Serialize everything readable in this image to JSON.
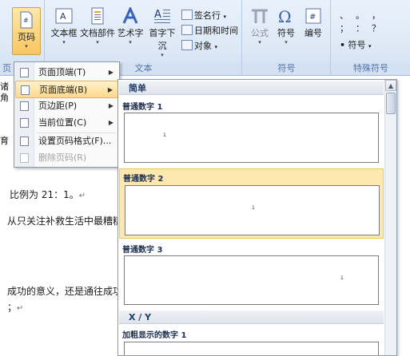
{
  "ribbon": {
    "page_number_btn": "页码",
    "insert_text_group": {
      "textbox": "文本框",
      "quickparts": "文档部件",
      "wordart": "艺术字",
      "dropcap": "首字下沉",
      "signature_line": "签名行",
      "datetime": "日期和时间",
      "object": "对象",
      "label": "文本"
    },
    "symbols_group": {
      "equation": "公式",
      "symbol": "符号",
      "numbering": "编号",
      "label": "符号"
    },
    "special_group": {
      "symbol_btn": "符号",
      "label": "特殊符号",
      "glyphs": [
        "、",
        "。",
        "，",
        "；",
        "：",
        "？"
      ]
    },
    "hdr_label_fragment": "页",
    "dd_arrow": "▾"
  },
  "document": {
    "lines": [
      {
        "text": "比例为 21：1。",
        "mark": "↵"
      },
      {
        "text": "从只关注补救生活中最糟糕"
      },
      {
        "text": "成功的意义，还是通往成功"
      },
      {
        "text": "；",
        "mark": "↵"
      }
    ],
    "edge_fragments": [
      "诸",
      "角",
      "育"
    ]
  },
  "menu": {
    "items": [
      {
        "label": "页面顶端(T)",
        "submenu": true
      },
      {
        "label": "页面底端(B)",
        "submenu": true,
        "active": true
      },
      {
        "label": "页边距(P)",
        "submenu": true
      },
      {
        "label": "当前位置(C)",
        "submenu": true
      },
      {
        "label": "设置页码格式(F)..."
      },
      {
        "label": "删除页码(R)",
        "disabled": true
      }
    ],
    "arrow": "▶"
  },
  "gallery": {
    "sections": [
      {
        "header": "简单"
      },
      {
        "header": "X / Y"
      }
    ],
    "items": [
      {
        "title": "普通数字 1",
        "num": "1",
        "align": "left"
      },
      {
        "title": "普通数字 2",
        "num": "1",
        "align": "center",
        "hot": true
      },
      {
        "title": "普通数字 3",
        "num": "1",
        "align": "right"
      },
      {
        "title": "加粗显示的数字 1"
      }
    ],
    "scroll": {
      "up": "▲",
      "down": "▼"
    }
  }
}
